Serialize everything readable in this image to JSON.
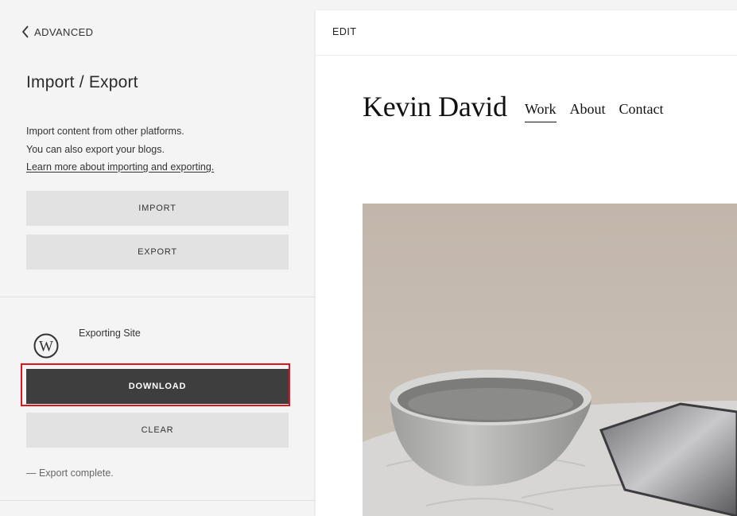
{
  "sidebar": {
    "back_label": "ADVANCED",
    "title": "Import / Export",
    "description_line1": "Import content from other platforms.",
    "description_line2": "You can also export your blogs.",
    "learn_more_link": "Learn more about importing and exporting.",
    "import_button": "IMPORT",
    "export_button": "EXPORT",
    "export_job": {
      "icon": "wordpress-icon",
      "label": "Exporting Site",
      "download_button": "DOWNLOAD",
      "clear_button": "CLEAR",
      "status": "— Export complete."
    }
  },
  "preview": {
    "edit_label": "EDIT",
    "site_title": "Kevin David",
    "nav": [
      {
        "label": "Work",
        "active": true
      },
      {
        "label": "About",
        "active": false
      },
      {
        "label": "Contact",
        "active": false
      }
    ],
    "hero_image": "bowl-photo"
  },
  "colors": {
    "panel_bg": "#f4f4f4",
    "button_bg": "#e2e2e2",
    "primary_button_bg": "#3e3e3e",
    "highlight_border": "#e2141b"
  }
}
